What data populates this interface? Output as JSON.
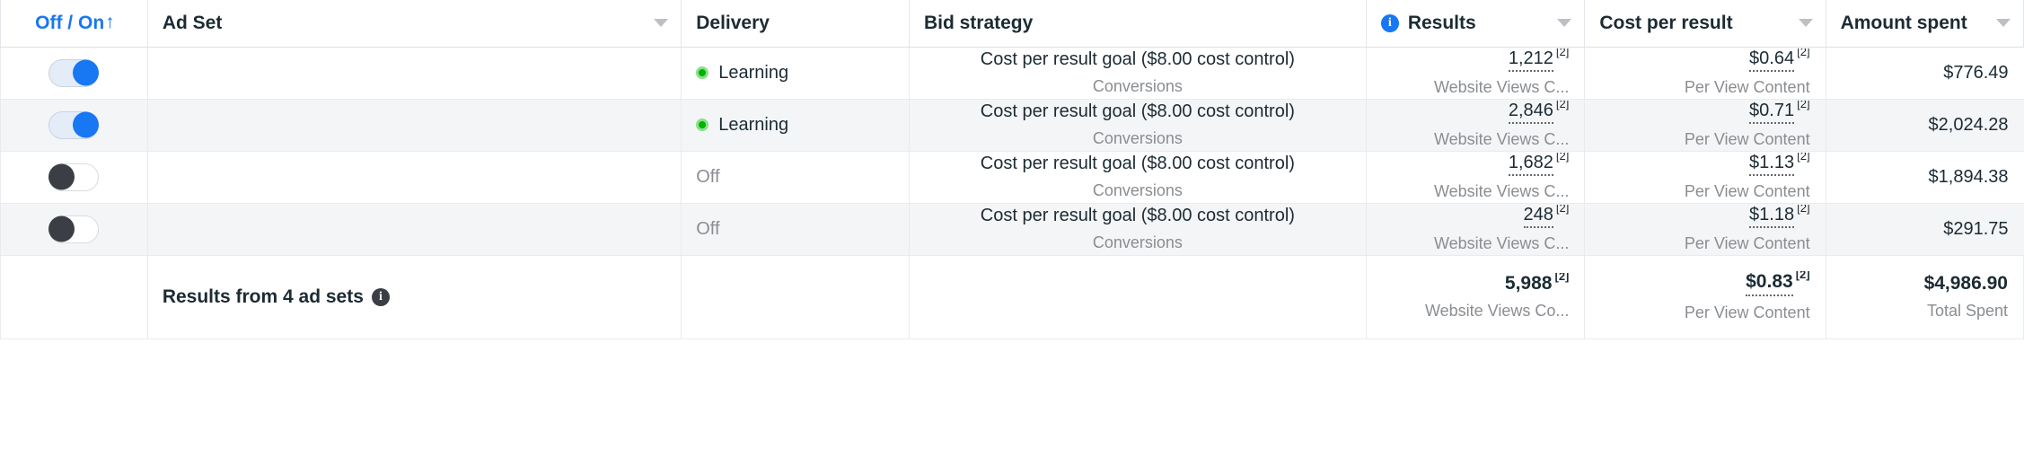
{
  "table": {
    "columns": [
      {
        "key": "toggle",
        "label": "Off / On",
        "sorted": true,
        "sort_arrow": "↑",
        "has_caret": false,
        "align": "center"
      },
      {
        "key": "adset",
        "label": "Ad Set",
        "sorted": false,
        "has_caret": true,
        "align": "left"
      },
      {
        "key": "delivery",
        "label": "Delivery",
        "sorted": false,
        "has_caret": false,
        "align": "left"
      },
      {
        "key": "bid",
        "label": "Bid strategy",
        "sorted": false,
        "has_caret": false,
        "align": "left"
      },
      {
        "key": "results",
        "label": "Results",
        "sorted": false,
        "has_caret": true,
        "align": "left",
        "info_icon": "info-icon"
      },
      {
        "key": "cpr",
        "label": "Cost per result",
        "sorted": false,
        "has_caret": true,
        "align": "left"
      },
      {
        "key": "spent",
        "label": "Amount spent",
        "sorted": false,
        "has_caret": true,
        "align": "left"
      }
    ],
    "rows": [
      {
        "toggle_state": "on",
        "ad_set": "",
        "delivery_status": "Learning",
        "delivery_state": "active",
        "bid_strategy": "Cost per result goal ($8.00 cost control)",
        "bid_strategy_sub": "Conversions",
        "results_value": "1,212",
        "results_superscript": "[2]",
        "results_sub": "Website Views C...",
        "cost_per_result_value": "$0.64",
        "cost_per_result_superscript": "[2]",
        "cost_per_result_sub": "Per View Content",
        "amount_spent": "$776.49"
      },
      {
        "toggle_state": "on",
        "ad_set": "",
        "delivery_status": "Learning",
        "delivery_state": "active",
        "bid_strategy": "Cost per result goal ($8.00 cost control)",
        "bid_strategy_sub": "Conversions",
        "results_value": "2,846",
        "results_superscript": "[2]",
        "results_sub": "Website Views C...",
        "cost_per_result_value": "$0.71",
        "cost_per_result_superscript": "[2]",
        "cost_per_result_sub": "Per View Content",
        "amount_spent": "$2,024.28"
      },
      {
        "toggle_state": "off",
        "ad_set": "",
        "delivery_status": "Off",
        "delivery_state": "off",
        "bid_strategy": "Cost per result goal ($8.00 cost control)",
        "bid_strategy_sub": "Conversions",
        "results_value": "1,682",
        "results_superscript": "[2]",
        "results_sub": "Website Views C...",
        "cost_per_result_value": "$1.13",
        "cost_per_result_superscript": "[2]",
        "cost_per_result_sub": "Per View Content",
        "amount_spent": "$1,894.38"
      },
      {
        "toggle_state": "off",
        "ad_set": "",
        "delivery_status": "Off",
        "delivery_state": "off",
        "bid_strategy": "Cost per result goal ($8.00 cost control)",
        "bid_strategy_sub": "Conversions",
        "results_value": "248",
        "results_superscript": "[2]",
        "results_sub": "Website Views C...",
        "cost_per_result_value": "$1.18",
        "cost_per_result_superscript": "[2]",
        "cost_per_result_sub": "Per View Content",
        "amount_spent": "$291.75"
      }
    ],
    "summary": {
      "label": "Results from 4 ad sets",
      "info_icon": "info-icon",
      "results_value": "5,988",
      "results_superscript": "[2]",
      "results_sub": "Website Views Co...",
      "cost_per_result_value": "$0.83",
      "cost_per_result_superscript": "[2]",
      "cost_per_result_sub": "Per View Content",
      "amount_spent": "$4,986.90",
      "amount_spent_sub": "Total Spent"
    }
  },
  "colors": {
    "accent": "#1877f2",
    "status_active": "#00b200",
    "text_primary": "#1c2b33",
    "text_muted": "#8a8d91",
    "row_alt": "#f4f5f7"
  }
}
